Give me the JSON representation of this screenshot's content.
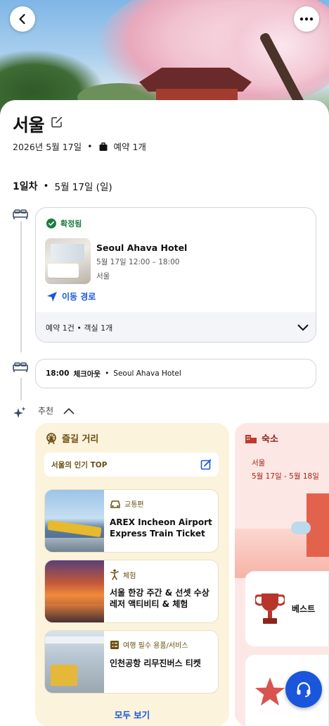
{
  "trip": {
    "city": "서울",
    "date": "2026년 5월 17일",
    "dot": "•",
    "bookings": "예약 1개"
  },
  "day": {
    "label": "1일차",
    "dot": "•",
    "date": "5월 17일 (일)"
  },
  "hotel": {
    "status": "확정됨",
    "name": "Seoul Ahava Hotel",
    "time": "5월 17일 12:00 – 18:00",
    "city": "서울",
    "route_label": "이동 경로",
    "summary": "예약 1건 • 객실 1개"
  },
  "checkout": {
    "time": "18:00",
    "label": "체크아웃",
    "dot": "•",
    "hotel": "Seoul Ahava Hotel"
  },
  "recommend": {
    "label": "추천"
  },
  "activities": {
    "title": "즐길 거리",
    "top_label": "서울의 인기 TOP",
    "items": [
      {
        "category": "교통편",
        "name": "AREX Incheon Airport Express Train Ticket"
      },
      {
        "category": "체험",
        "name": "서울 한강 주간 & 선셋 수상 레저 액티비티 & 체험"
      },
      {
        "category": "여행 필수 용품/서비스",
        "name": "인천공항 리무진버스 티켓"
      }
    ],
    "see_all": "모두 보기"
  },
  "lodging": {
    "title": "숙소",
    "city": "서울",
    "dates": "5월 17일 - 5월 18일",
    "best_label": "베스트"
  },
  "colors": {
    "accent": "#1a56db",
    "confirmed": "#1a7d3b",
    "activity_bg": "#fbf3dc",
    "lodging_bg": "#fde7e4"
  }
}
